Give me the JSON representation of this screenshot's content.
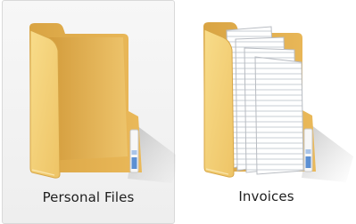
{
  "explorer": {
    "items": [
      {
        "label": "Personal Files",
        "icon": "folder-empty-icon",
        "selected": true
      },
      {
        "label": "Invoices",
        "icon": "folder-documents-icon",
        "selected": false
      }
    ]
  },
  "colors": {
    "selection_background": "#eeeeee",
    "selection_border": "#d9d9d9",
    "folder_front": "#f3d27c",
    "folder_back": "#e0b04c",
    "label_text": "#1e1e1e"
  }
}
